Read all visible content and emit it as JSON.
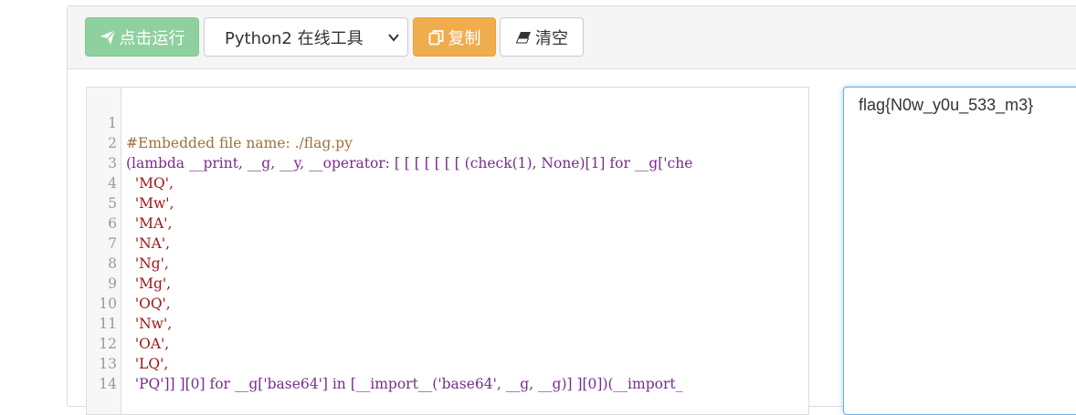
{
  "toolbar": {
    "run_label": "点击运行",
    "run_icon": "paper-plane-icon",
    "language_select": "Python2 在线工具",
    "copy_label": "复制",
    "copy_icon": "copy-icon",
    "clear_label": "清空",
    "clear_icon": "eraser-icon"
  },
  "colors": {
    "run_button": "#8fd19e",
    "copy_button": "#f0ad4e",
    "output_border": "#66afe9"
  },
  "editor": {
    "lines": [
      {
        "n": "1",
        "text": "#Embedded file name: ./flag.py"
      },
      {
        "n": "2",
        "text": "(lambda __print, __g, __y, __operator: [ [ [ [ [ [ [ (check(1), None)[1] for __g['che"
      },
      {
        "n": "3",
        "text": "  'MQ',"
      },
      {
        "n": "4",
        "text": "  'Mw',"
      },
      {
        "n": "5",
        "text": "  'MA',"
      },
      {
        "n": "6",
        "text": "  'NA',"
      },
      {
        "n": "7",
        "text": "  'Ng',"
      },
      {
        "n": "8",
        "text": "  'Mg',"
      },
      {
        "n": "9",
        "text": "  'OQ',"
      },
      {
        "n": "10",
        "text": "  'Nw',"
      },
      {
        "n": "11",
        "text": "  'OA',"
      },
      {
        "n": "12",
        "text": "  'LQ',"
      },
      {
        "n": "13",
        "text": "  'PQ']] ][0] for __g['base64'] in [__import__('base64', __g, __g)] ][0])(__import_"
      },
      {
        "n": "14",
        "text": ""
      }
    ]
  },
  "output": {
    "text": "flag{N0w_y0u_533_m3}"
  }
}
